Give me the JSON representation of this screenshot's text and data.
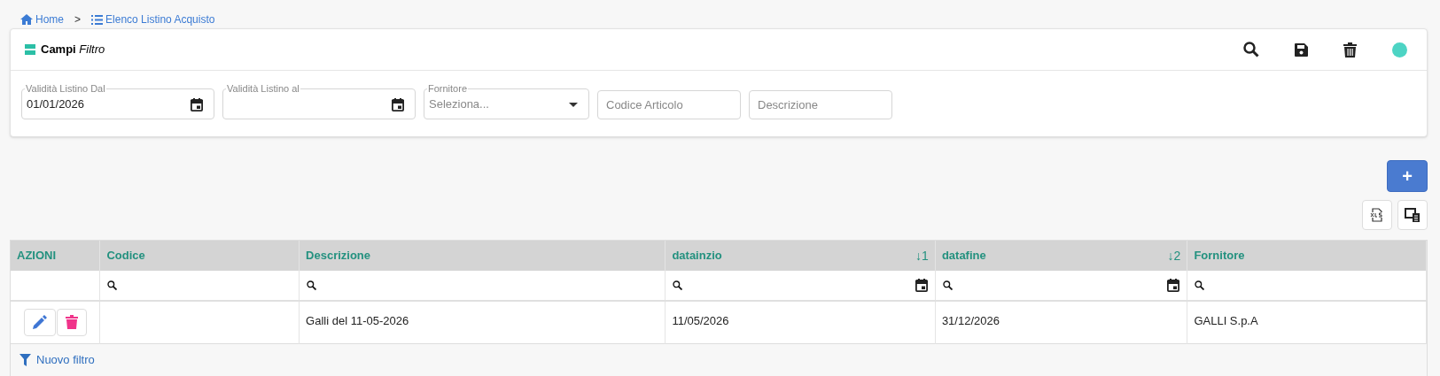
{
  "breadcrumb": [
    {
      "label": "Home"
    },
    {
      "label": "Elenco Listino Acquisto"
    }
  ],
  "breadcrumb_separator": ">",
  "filter_panel": {
    "title": "**Campi** *Filtro*",
    "status": {
      "color": "#4dd4c4"
    },
    "fields": [
      {
        "kind": "date",
        "label": "Validità Listino Dal",
        "value": "01/01/2026"
      },
      {
        "kind": "date",
        "label": "Validità Listino al"
      },
      {
        "kind": "select",
        "label": "Fornitore",
        "placeholder": "Seleziona..."
      },
      {
        "kind": "text",
        "placeholder": "Codice Articolo"
      },
      {
        "kind": "text",
        "placeholder": "Descrizione"
      }
    ]
  },
  "add_button": "+",
  "table": {
    "columns": [
      {
        "label": "AZIONI",
        "kind": "actions"
      },
      {
        "label": "Codice",
        "kind": "text"
      },
      {
        "label": "Descrizione",
        "kind": "text"
      },
      {
        "label": "datainzio",
        "sort": "↓1",
        "kind": "date"
      },
      {
        "label": "datafine",
        "sort": "↓2",
        "kind": "date"
      },
      {
        "label": "Fornitore",
        "kind": "text"
      }
    ],
    "rows": [
      {
        "descrizione": "Galli del 11-05-2026",
        "datainzio": "11/05/2026",
        "datafine": "31/12/2026",
        "fornitore": "GALLI S.p.A"
      }
    ],
    "footer_link": "Nuovo filtro"
  }
}
